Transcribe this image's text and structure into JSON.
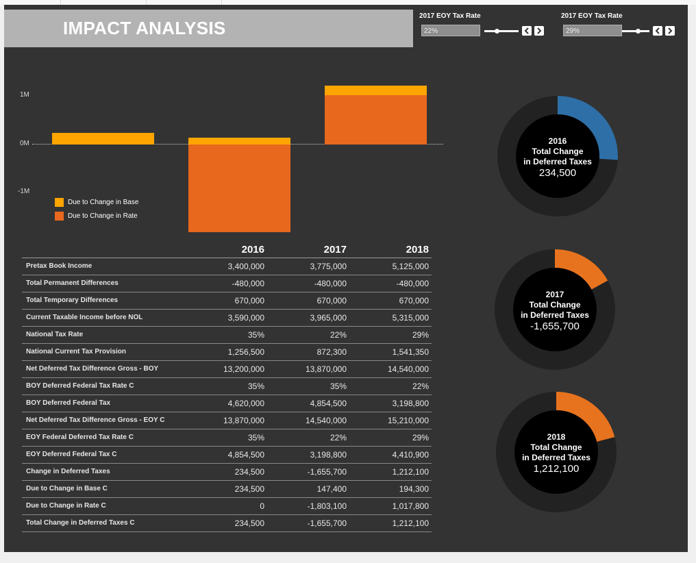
{
  "header": {
    "title": "IMPACT ANALYSIS"
  },
  "controls": [
    {
      "label": "2017 EOY Tax Rate",
      "value": "22%"
    },
    {
      "label": "2017 EOY Tax Rate",
      "value": "29%"
    }
  ],
  "colors": {
    "base": "#FFA500",
    "rate": "#E8681E",
    "donut_2016": "#2E6FA7",
    "donut_2017": "#E8731E",
    "donut_2018": "#E8731E",
    "ring_bg": "#222222"
  },
  "chart_data": {
    "type": "bar",
    "stacked": true,
    "categories": [
      "2016",
      "2017",
      "2018"
    ],
    "series": [
      {
        "name": "Due to Change in Base",
        "values": [
          234500,
          147400,
          194300
        ]
      },
      {
        "name": "Due to Change in Rate",
        "values": [
          0,
          -1803100,
          1017800
        ]
      }
    ],
    "y_ticks": [
      "1M",
      "0M",
      "-1M"
    ],
    "ylim": [
      -1900000,
      1450000
    ],
    "legend_position": "bottom-left"
  },
  "table": {
    "years": [
      "2016",
      "2017",
      "2018"
    ],
    "rows": [
      {
        "label": "Pretax Book Income",
        "values": [
          "3,400,000",
          "3,775,000",
          "5,125,000"
        ]
      },
      {
        "label": "Total Permanent Differences",
        "values": [
          "-480,000",
          "-480,000",
          "-480,000"
        ]
      },
      {
        "label": "Total Temporary Differences",
        "values": [
          "670,000",
          "670,000",
          "670,000"
        ]
      },
      {
        "label": "Current Taxable Income before NOL",
        "values": [
          "3,590,000",
          "3,965,000",
          "5,315,000"
        ]
      },
      {
        "label": "National Tax Rate",
        "values": [
          "35%",
          "22%",
          "29%"
        ]
      },
      {
        "label": "National Current Tax Provision",
        "values": [
          "1,256,500",
          "872,300",
          "1,541,350"
        ]
      },
      {
        "label": "Net Deferred Tax Difference Gross - BOY",
        "values": [
          "13,200,000",
          "13,870,000",
          "14,540,000"
        ]
      },
      {
        "label": "BOY Deferred Federal Tax Rate C",
        "values": [
          "35%",
          "35%",
          "22%"
        ]
      },
      {
        "label": "BOY Deferred Federal Tax",
        "values": [
          "4,620,000",
          "4,854,500",
          "3,198,800"
        ]
      },
      {
        "label": "Net Deferred Tax Difference Gross - EOY C",
        "values": [
          "13,870,000",
          "14,540,000",
          "15,210,000"
        ]
      },
      {
        "label": "EOY Federal Deferred Tax Rate C",
        "values": [
          "35%",
          "22%",
          "29%"
        ]
      },
      {
        "label": "EOY Deferred Federal Tax C",
        "values": [
          "4,854,500",
          "3,198,800",
          "4,410,900"
        ]
      },
      {
        "label": "Change in Deferred Taxes",
        "values": [
          "234,500",
          "-1,655,700",
          "1,212,100"
        ]
      },
      {
        "label": "Due to Change in Base C",
        "values": [
          "234,500",
          "147,400",
          "194,300"
        ]
      },
      {
        "label": "Due to Change in Rate C",
        "values": [
          "0",
          "-1,803,100",
          "1,017,800"
        ]
      },
      {
        "label": "Total Change in Deferred Taxes C",
        "values": [
          "234,500",
          "-1,655,700",
          "1,212,100"
        ]
      }
    ]
  },
  "donuts": [
    {
      "year": "2016",
      "line1": "Total Change",
      "line2": "in Deferred Taxes",
      "value": "234,500",
      "fraction": 0.26
    },
    {
      "year": "2017",
      "line1": "Total Change",
      "line2": "in Deferred Taxes",
      "value": "-1,655,700",
      "fraction": 0.17
    },
    {
      "year": "2018",
      "line1": "Total Change",
      "line2": "in Deferred Taxes",
      "value": "1,212,100",
      "fraction": 0.21
    }
  ]
}
